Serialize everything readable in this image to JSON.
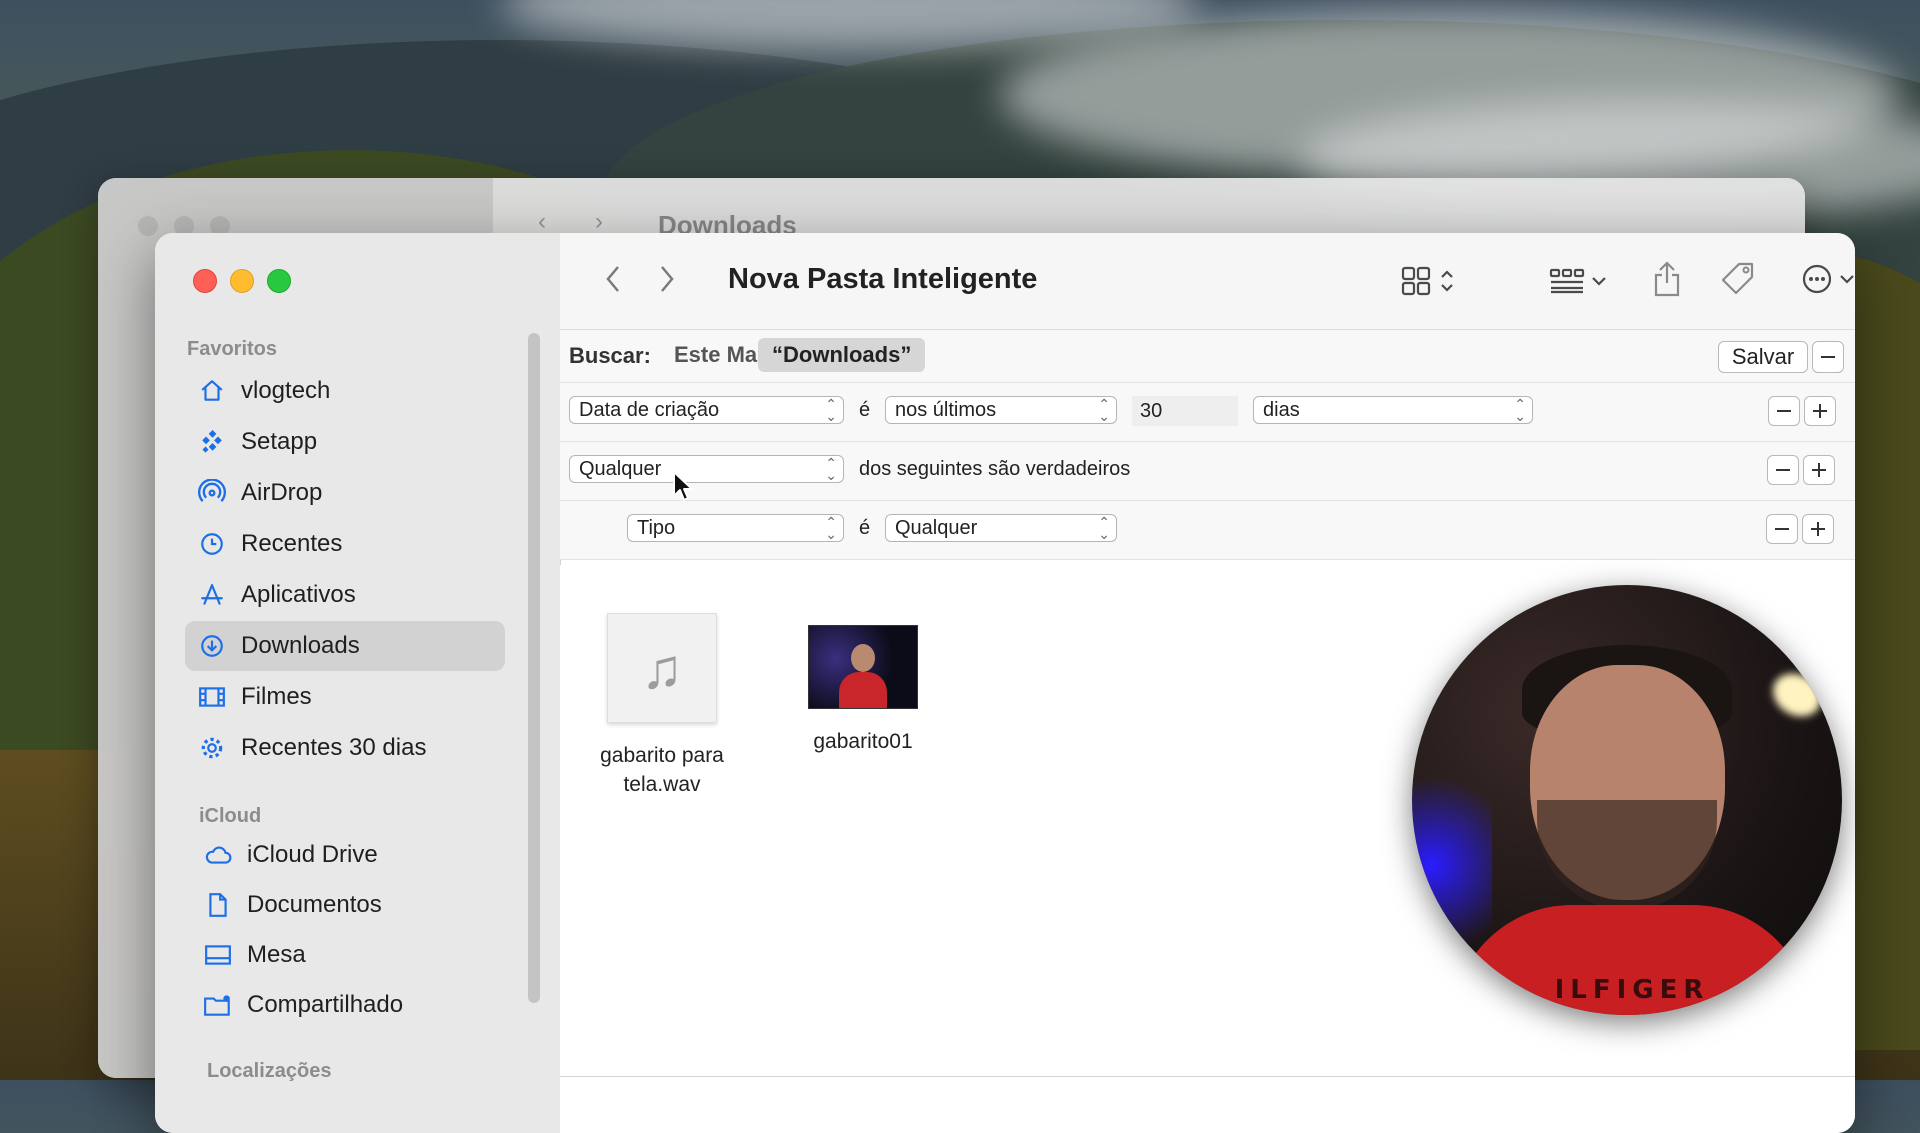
{
  "finder": {
    "title": "Nova Pasta Inteligente",
    "background_window_title": "Downloads"
  },
  "sidebar": {
    "favorites_header": "Favoritos",
    "favorites": [
      {
        "label": "vlogtech",
        "icon": "home-icon"
      },
      {
        "label": "Setapp",
        "icon": "setapp-icon"
      },
      {
        "label": "AirDrop",
        "icon": "airdrop-icon"
      },
      {
        "label": "Recentes",
        "icon": "clock-icon"
      },
      {
        "label": "Aplicativos",
        "icon": "applications-icon"
      },
      {
        "label": "Downloads",
        "icon": "download-icon",
        "selected": true
      },
      {
        "label": "Filmes",
        "icon": "film-icon"
      },
      {
        "label": "Recentes 30 dias",
        "icon": "gear-icon"
      }
    ],
    "icloud_header": "iCloud",
    "icloud": [
      {
        "label": "iCloud Drive",
        "icon": "cloud-icon"
      },
      {
        "label": "Documentos",
        "icon": "document-icon"
      },
      {
        "label": "Mesa",
        "icon": "desktop-icon"
      },
      {
        "label": "Compartilhado",
        "icon": "shared-folder-icon"
      }
    ],
    "locations_header": "Localizações"
  },
  "search": {
    "label": "Buscar:",
    "scope_mac": "Este Mac",
    "scope_downloads": "“Downloads”",
    "save_label": "Salvar",
    "minus": "—",
    "plus": "+"
  },
  "rules": {
    "rule1": {
      "attribute": "Data de criação",
      "verb": "é",
      "operator": "nos últimos",
      "value": "30",
      "unit": "dias"
    },
    "rule2": {
      "match": "Qualquer",
      "text": "dos seguintes são verdadeiros"
    },
    "rule3": {
      "attribute": "Tipo",
      "verb": "é",
      "value": "Qualquer"
    }
  },
  "files": [
    {
      "label_line1": "gabarito para",
      "label_line2": "tela.wav",
      "kind": "audio"
    },
    {
      "label_line1": "gabarito01",
      "label_line2": "",
      "kind": "video"
    }
  ],
  "webcam": {
    "shirt_text": "ILFIGER"
  },
  "colors": {
    "accent": "#1d6fe8",
    "selected_bg": "#d2d2d2",
    "close": "#fe5f57",
    "minimize": "#febc2e",
    "zoom": "#28c840"
  }
}
